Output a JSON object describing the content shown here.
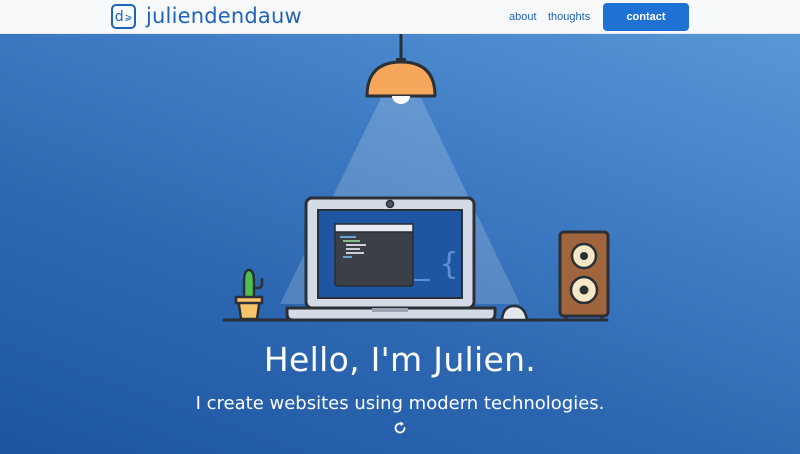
{
  "brand": {
    "mark_letter": "d",
    "mark_arrow": "⩾",
    "name": "juliendendauw"
  },
  "nav": {
    "about": "about",
    "thoughts": "thoughts",
    "contact": "contact"
  },
  "hero": {
    "title": "Hello, I'm Julien.",
    "subtitle": "I create websites using modern technologies.",
    "reload_icon": "refresh-icon"
  },
  "colors": {
    "brand": "#1f63b9",
    "cta": "#1f71d4",
    "hero_top": "#5a97d6",
    "hero_bottom": "#1d55a1"
  }
}
